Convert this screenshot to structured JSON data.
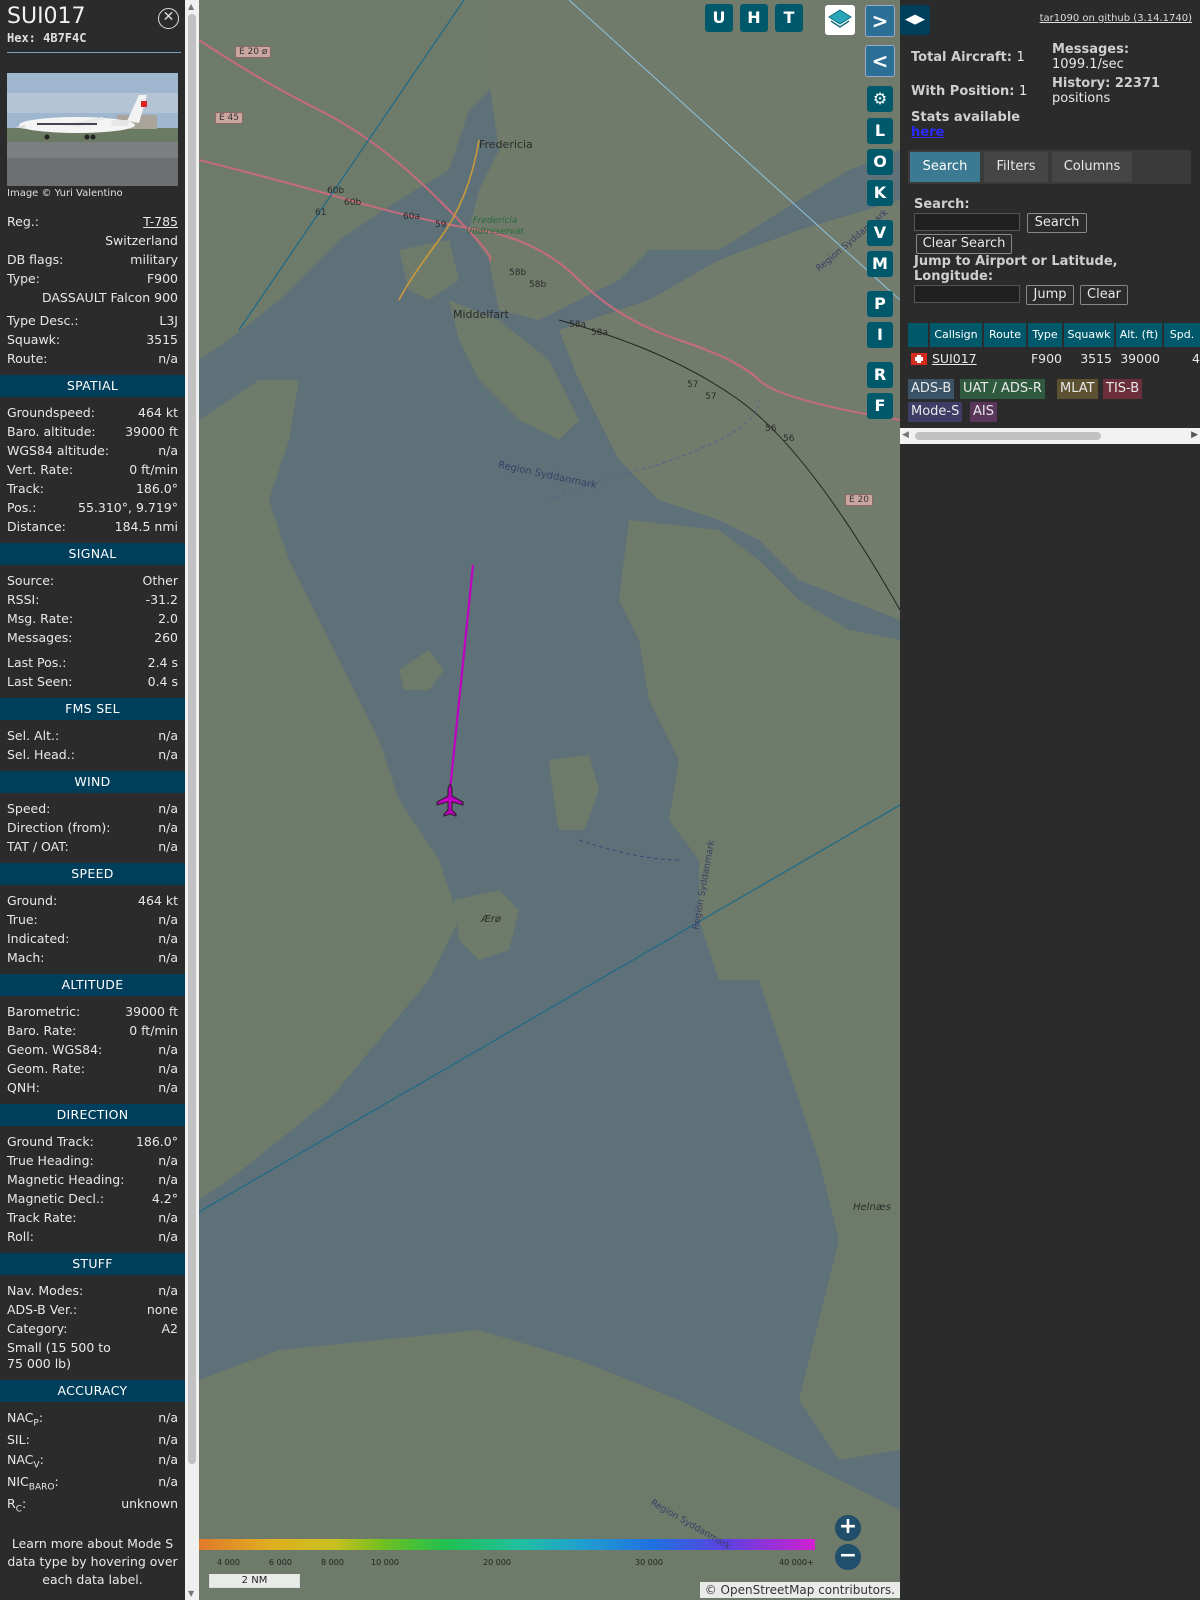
{
  "aircraft": {
    "callsign": "SUI017",
    "hex": "Hex: 4B7F4C",
    "photo_credit": "Image © Yuri Valentino",
    "reg_label": "Reg.:",
    "reg_value": "T-785",
    "country": "Switzerland",
    "dbflags_label": "DB flags:",
    "dbflags_value": "military",
    "type_label": "Type:",
    "type_value": "F900",
    "type_full": "DASSAULT Falcon 900",
    "typedesc_label": "Type Desc.:",
    "typedesc_value": "L3J",
    "squawk_label": "Squawk:",
    "squawk_value": "3515",
    "route_label": "Route:",
    "route_value": "n/a"
  },
  "sections": {
    "spatial": "SPATIAL",
    "signal": "SIGNAL",
    "fms": "FMS SEL",
    "wind": "WIND",
    "speed": "SPEED",
    "altitude": "ALTITUDE",
    "direction": "DIRECTION",
    "stuff": "STUFF",
    "accuracy": "ACCURACY"
  },
  "spatial": [
    {
      "label": "Groundspeed:",
      "value": "464 kt"
    },
    {
      "label": "Baro. altitude:",
      "value": "39000 ft"
    },
    {
      "label": "WGS84 altitude:",
      "value": "n/a"
    },
    {
      "label": "Vert. Rate:",
      "value": "0 ft/min"
    },
    {
      "label": "Track:",
      "value": "186.0°"
    },
    {
      "label": "Pos.:",
      "value": "55.310°, 9.719°"
    },
    {
      "label": "Distance:",
      "value": "184.5 nmi"
    }
  ],
  "signal": [
    {
      "label": "Source:",
      "value": "Other"
    },
    {
      "label": "RSSI:",
      "value": "-31.2"
    },
    {
      "label": "Msg. Rate:",
      "value": "2.0"
    },
    {
      "label": "Messages:",
      "value": "260"
    },
    {
      "label": "Last Pos.:",
      "value": "2.4 s"
    },
    {
      "label": "Last Seen:",
      "value": "0.4 s"
    }
  ],
  "fms": [
    {
      "label": "Sel. Alt.:",
      "value": "n/a"
    },
    {
      "label": "Sel. Head.:",
      "value": "n/a"
    }
  ],
  "wind": [
    {
      "label": "Speed:",
      "value": "n/a"
    },
    {
      "label": "Direction (from):",
      "value": "n/a"
    },
    {
      "label": "TAT / OAT:",
      "value": "n/a"
    }
  ],
  "speed": [
    {
      "label": "Ground:",
      "value": "464 kt"
    },
    {
      "label": "True:",
      "value": "n/a"
    },
    {
      "label": "Indicated:",
      "value": "n/a"
    },
    {
      "label": "Mach:",
      "value": "n/a"
    }
  ],
  "altitude": [
    {
      "label": "Barometric:",
      "value": "39000 ft"
    },
    {
      "label": "Baro. Rate:",
      "value": "0 ft/min"
    },
    {
      "label": "Geom. WGS84:",
      "value": "n/a"
    },
    {
      "label": "Geom. Rate:",
      "value": "n/a"
    },
    {
      "label": "QNH:",
      "value": "n/a"
    }
  ],
  "direction": [
    {
      "label": "Ground Track:",
      "value": "186.0°"
    },
    {
      "label": "True Heading:",
      "value": "n/a"
    },
    {
      "label": "Magnetic Heading:",
      "value": "n/a"
    },
    {
      "label": "Magnetic Decl.:",
      "value": "4.2°"
    },
    {
      "label": "Track Rate:",
      "value": "n/a"
    },
    {
      "label": "Roll:",
      "value": "n/a"
    }
  ],
  "stuff": [
    {
      "label": "Nav. Modes:",
      "value": "n/a"
    },
    {
      "label": "ADS-B Ver.:",
      "value": "none"
    },
    {
      "label": "Category:",
      "value": "A2"
    }
  ],
  "stuff_category_desc": "Small (15 500 to 75 000 lb)",
  "accuracy": [
    {
      "label": "NACP:",
      "value": "n/a"
    },
    {
      "label": "SIL:",
      "value": "n/a"
    },
    {
      "label": "NACV:",
      "value": "n/a"
    },
    {
      "label": "NICBARO:",
      "value": "n/a"
    },
    {
      "label": "RC:",
      "value": "unknown"
    }
  ],
  "footnote": "Learn more about Mode S data type by hovering over each data label.",
  "map": {
    "top_buttons": [
      "U",
      "H",
      "T"
    ],
    "side_buttons": [
      "L",
      "O",
      "K",
      "V",
      "M",
      "P",
      "I",
      "R",
      "F"
    ],
    "labels": {
      "fredericia": "Fredericia",
      "middelfart": "Middelfart",
      "reservat": "Fredericia Vildtreservat",
      "region_syd1": "Region Syddanmark",
      "region_syd2": "Region Syddanmark",
      "region_syd3": "Region Syddanmark",
      "region_syd4": "Region Syddanmark",
      "aro": "Ærø",
      "helnaes": "Helnæs"
    },
    "roads": [
      "E 20 ø",
      "E 45",
      "E 20"
    ],
    "road_numbers": [
      "60b",
      "60b",
      "61",
      "60a",
      "59",
      "58b",
      "58b",
      "58a",
      "58a",
      "57",
      "57",
      "56",
      "56"
    ],
    "altitude_scale": [
      "4 000",
      "6 000",
      "8 000",
      "10 000",
      "20 000",
      "30 000",
      "40 000+"
    ],
    "nm_scale": "2 NM",
    "attribution": "© OpenStreetMap contributors.",
    "colors": {
      "water": "#5f7178",
      "land": "#6e7a6a",
      "track": "#c000c0",
      "aircraft": "#c000c0"
    }
  },
  "right": {
    "github": "tar1090 on github (3.14.1740)",
    "total_label": "Total Aircraft:",
    "total_value": "1",
    "withpos_label": "With Position:",
    "withpos_value": "1",
    "stats_label": "Stats available",
    "stats_link": "here",
    "messages_label": "Messages:",
    "messages_value": "1099.1/sec",
    "history_label": "History: 22371",
    "history_value": "positions",
    "tabs": [
      "Search",
      "Filters",
      "Columns"
    ],
    "search_label": "Search:",
    "search_btn": "Search",
    "clear_search_btn": "Clear Search",
    "jump_label": "Jump to Airport or Latitude, Longitude:",
    "jump_btn": "Jump",
    "clear_btn": "Clear",
    "columns": [
      "Callsign",
      "Route",
      "Type",
      "Squawk",
      "Alt. (ft)",
      "Spd."
    ],
    "rows": [
      {
        "callsign": "SUI017",
        "route": "",
        "type": "F900",
        "squawk": "3515",
        "alt": "39000",
        "spd": "4"
      }
    ],
    "legend": [
      {
        "label": "ADS-B",
        "color": "#3a5366"
      },
      {
        "label": "UAT / ADS-R",
        "color": "#2f5a3f"
      },
      {
        "label": "MLAT",
        "color": "#5c5232"
      },
      {
        "label": "TIS-B",
        "color": "#6b2f3b"
      },
      {
        "label": "Mode-S",
        "color": "#3d3d66"
      },
      {
        "label": "AIS",
        "color": "#5b365b"
      }
    ]
  }
}
